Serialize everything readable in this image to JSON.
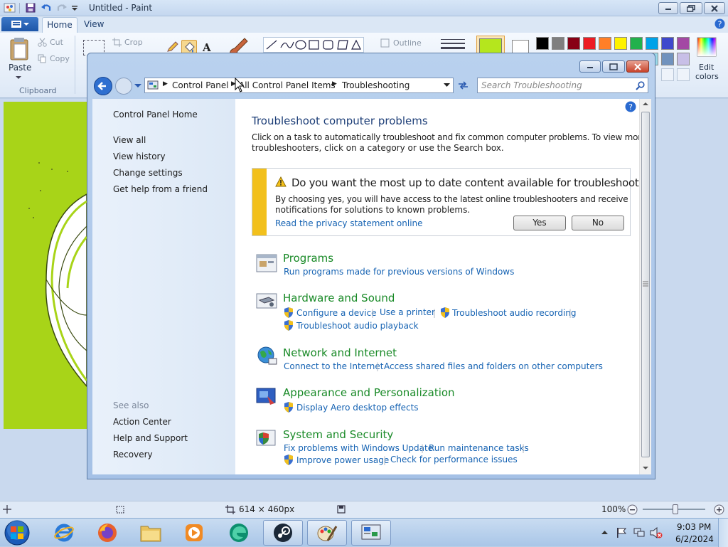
{
  "paint": {
    "title": "Untitled - Paint",
    "tabs": {
      "home": "Home",
      "view": "View"
    },
    "clipboard": {
      "paste": "Paste",
      "cut": "Cut",
      "copy": "Copy",
      "group": "Clipboard"
    },
    "image": {
      "crop": "Crop"
    },
    "shapes": {
      "outline": "Outline"
    },
    "edit_colors": {
      "line1": "Edit",
      "line2": "colors"
    },
    "palette": [
      "#000000",
      "#7f7f7f",
      "#880015",
      "#ed1c24",
      "#ff7f27",
      "#fff200",
      "#22b14c",
      "#00a2e8",
      "#3f48cc",
      "#a349a4"
    ],
    "palette_row2": [
      "#ffffff",
      "#c3c3c3",
      "#b97a57",
      "#ffaec9",
      "#ffc90e",
      "#efe4b0",
      "#b5e61d",
      "#99d9ea",
      "#7092be",
      "#c8bfe7"
    ],
    "color1": "#b5e61d",
    "canvas_color": "#a8d418",
    "status": {
      "size": "614 × 460px",
      "zoom": "100%"
    }
  },
  "cp": {
    "breadcrumb": [
      "Control Panel",
      "All Control Panel Items",
      "Troubleshooting"
    ],
    "search_placeholder": "Search Troubleshooting",
    "left": {
      "home": "Control Panel Home",
      "links": [
        "View all",
        "View history",
        "Change settings",
        "Get help from a friend"
      ],
      "see_also": "See also",
      "also": [
        "Action Center",
        "Help and Support",
        "Recovery"
      ]
    },
    "heading": "Troubleshoot computer problems",
    "intro": [
      "Click on a task to automatically troubleshoot and fix common computer problems. To view more",
      "troubleshooters, click on a category or use the Search box."
    ],
    "banner": {
      "title": "Do you want the most up to date content available for troubleshoot...",
      "body": [
        "By choosing yes, you will have access to the latest online troubleshooters and receive",
        "notifications for solutions to known problems."
      ],
      "privacy": "Read the privacy statement online",
      "yes": "Yes",
      "no": "No"
    },
    "categories": {
      "programs": {
        "title": "Programs",
        "tasks": [
          "Run programs made for previous versions of Windows"
        ]
      },
      "hardware": {
        "title": "Hardware and Sound",
        "tasks": [
          "Configure a device",
          "Use a printer",
          "Troubleshoot audio recording",
          "Troubleshoot audio playback"
        ]
      },
      "network": {
        "title": "Network and Internet",
        "tasks": [
          "Connect to the Internet",
          "Access shared files and folders on other computers"
        ]
      },
      "appearance": {
        "title": "Appearance and Personalization",
        "tasks": [
          "Display Aero desktop effects"
        ]
      },
      "system": {
        "title": "System and Security",
        "tasks": [
          "Fix problems with Windows Update",
          "Run maintenance tasks",
          "Improve power usage",
          "Check for performance issues"
        ]
      }
    }
  },
  "taskbar": {
    "apps": [
      "internet-explorer",
      "firefox",
      "file-explorer",
      "media-player",
      "edge",
      "steam",
      "paint",
      "control-panel"
    ],
    "time": "9:03 PM",
    "date": "6/2/2024"
  }
}
